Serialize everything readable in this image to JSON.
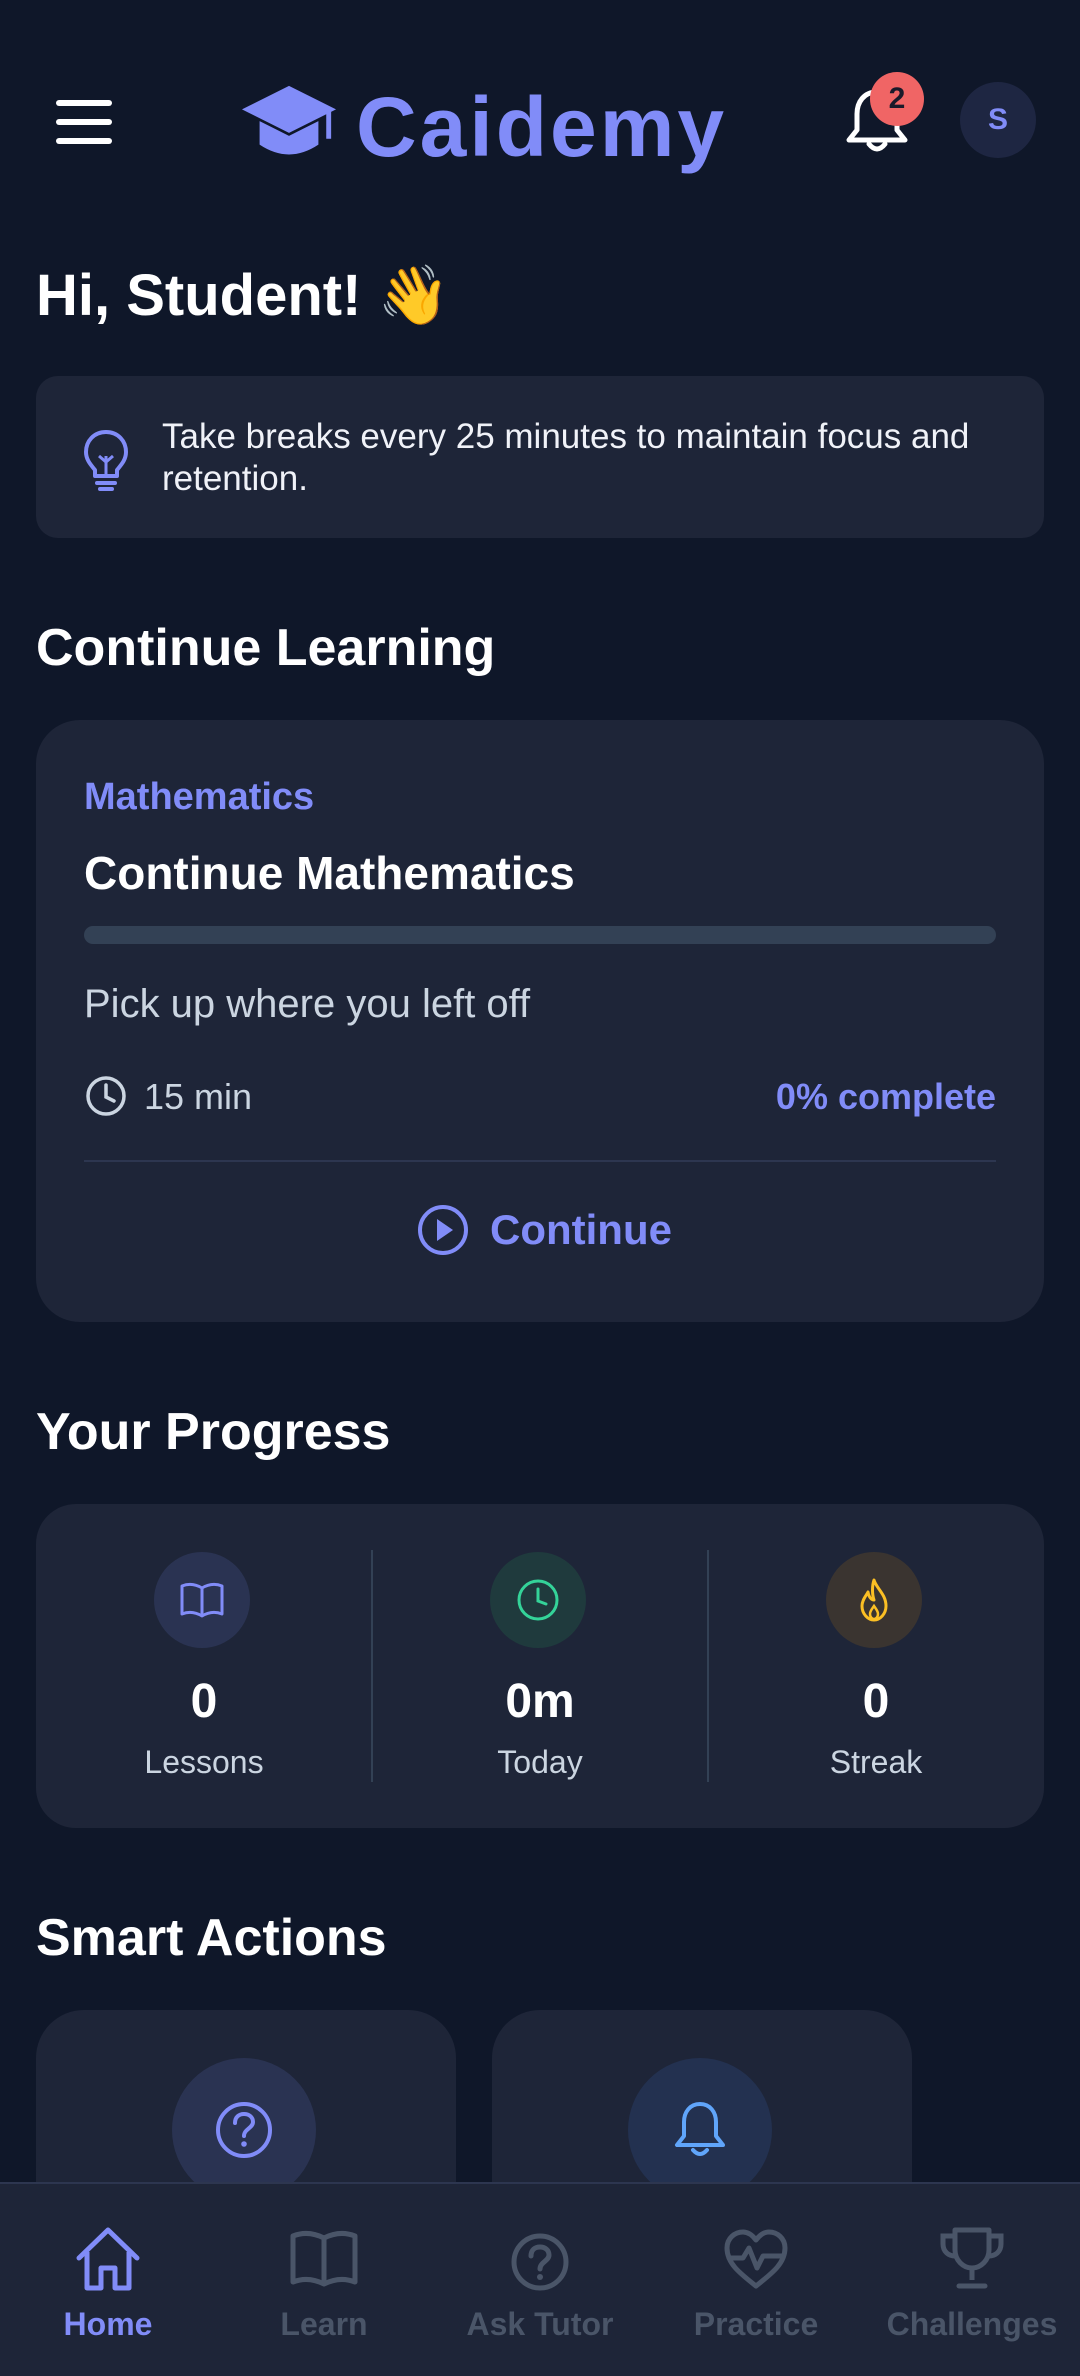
{
  "header": {
    "app_name": "Caidemy",
    "notification_count": "2",
    "avatar_initial": "S"
  },
  "greeting": "Hi, Student! 👋",
  "tip": {
    "text": "Take breaks every 25 minutes to maintain focus and retention.",
    "icon": "lightbulb-icon"
  },
  "continue_learning": {
    "section_title": "Continue Learning",
    "subject": "Mathematics",
    "title": "Continue Mathematics",
    "progress_fraction": 0,
    "description": "Pick up where you left off",
    "duration": "15 min",
    "percent_label": "0% complete",
    "button_label": "Continue"
  },
  "your_progress": {
    "section_title": "Your Progress",
    "stats": [
      {
        "value": "0",
        "label": "Lessons",
        "icon": "book-icon",
        "color": "#818cf8"
      },
      {
        "value": "0m",
        "label": "Today",
        "icon": "clock-icon",
        "color": "#34d399"
      },
      {
        "value": "0",
        "label": "Streak",
        "icon": "flame-icon",
        "color": "#fbbf24"
      }
    ]
  },
  "smart_actions": {
    "section_title": "Smart Actions",
    "items": [
      {
        "icon": "question-circle-icon",
        "color": "#818cf8"
      },
      {
        "icon": "bell-icon",
        "color": "#60a5fa"
      }
    ]
  },
  "bottom_nav": {
    "items": [
      {
        "label": "Home",
        "icon": "home-icon",
        "active": true
      },
      {
        "label": "Learn",
        "icon": "book-open-icon",
        "active": false
      },
      {
        "label": "Ask Tutor",
        "icon": "question-circle-icon",
        "active": false
      },
      {
        "label": "Practice",
        "icon": "heart-pulse-icon",
        "active": false
      },
      {
        "label": "Challenges",
        "icon": "trophy-icon",
        "active": false
      }
    ]
  },
  "colors": {
    "background": "#0f1729",
    "card": "#1e2538",
    "accent": "#818cf8",
    "badge": "#f06565",
    "muted_nav": "#4a5568"
  }
}
